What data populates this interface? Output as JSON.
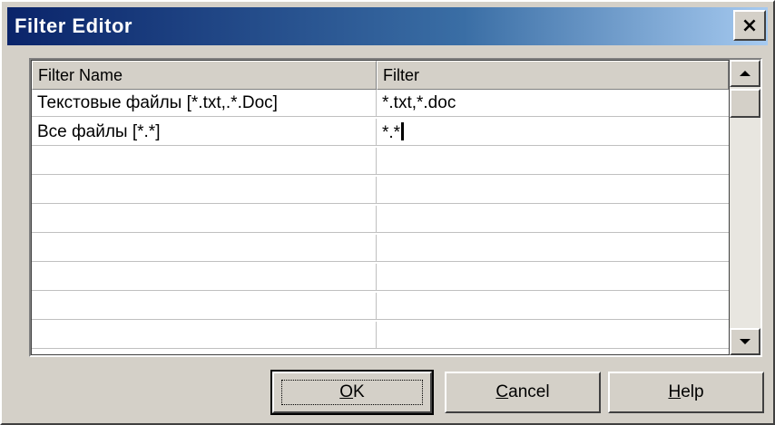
{
  "window": {
    "title": "Filter Editor",
    "close_glyph": "×"
  },
  "grid": {
    "columns": [
      "Filter Name",
      "Filter"
    ],
    "rows": [
      {
        "name": "Текстовые файлы [*.txt,.*.Doc]",
        "filter": "*.txt,*.doc"
      },
      {
        "name": "Все файлы [*.*]",
        "filter": "*.*"
      },
      {
        "name": "",
        "filter": ""
      },
      {
        "name": "",
        "filter": ""
      },
      {
        "name": "",
        "filter": ""
      },
      {
        "name": "",
        "filter": ""
      },
      {
        "name": "",
        "filter": ""
      },
      {
        "name": "",
        "filter": ""
      },
      {
        "name": "",
        "filter": ""
      }
    ]
  },
  "buttons": {
    "ok": {
      "mnemonic": "O",
      "rest": "K"
    },
    "cancel": {
      "mnemonic": "C",
      "rest": "ancel"
    },
    "help": {
      "mnemonic": "H",
      "rest": "elp"
    }
  },
  "icons": {
    "close": "close-icon",
    "scroll_up": "arrow-up-icon",
    "scroll_down": "arrow-down-icon"
  },
  "colors": {
    "titlebar_start": "#0a246a",
    "titlebar_end": "#a6caf0",
    "face": "#d4d0c8"
  }
}
